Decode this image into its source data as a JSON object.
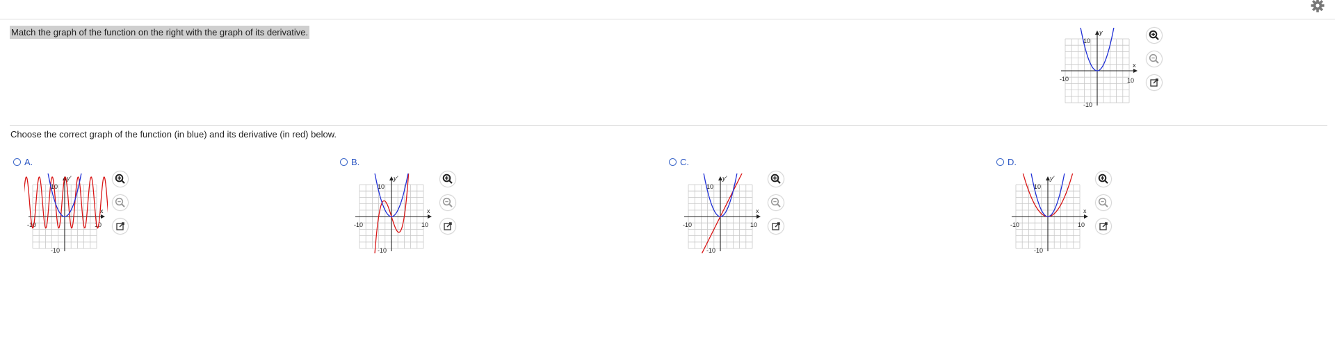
{
  "question": "Match the graph of the function on the right with the graph of its derivative.",
  "instruction": "Choose the correct graph of the function (in blue) and its derivative (in red) below.",
  "icons": {
    "settings": "gear-icon",
    "zoom_in": "zoom-in-icon",
    "zoom_out": "zoom-out-icon",
    "popout": "external-link-icon"
  },
  "colors": {
    "function": "#1f2fd6",
    "derivative": "#d91515",
    "option_label": "#2a55c3"
  },
  "given_graph": {
    "y_axis_label": "y",
    "x_axis_label": "x",
    "tick_min": "-10",
    "tick_max": "10",
    "tick_y_top": "10",
    "tick_y_bottom": "-10"
  },
  "options": [
    {
      "label": "A.",
      "y_axis_label": "y'",
      "x_axis_label": "x",
      "tick_min": "-10",
      "tick_max": "10",
      "tick_y_top": "10",
      "tick_y_bottom": "-10",
      "derivative_kind": "oscillating"
    },
    {
      "label": "B.",
      "y_axis_label": "y'",
      "x_axis_label": "x",
      "tick_min": "-10",
      "tick_max": "10",
      "tick_y_top": "10",
      "tick_y_bottom": "-10",
      "derivative_kind": "cubic"
    },
    {
      "label": "C.",
      "y_axis_label": "y'",
      "x_axis_label": "x",
      "tick_min": "-10",
      "tick_max": "10",
      "tick_y_top": "10",
      "tick_y_bottom": "-10",
      "derivative_kind": "linear"
    },
    {
      "label": "D.",
      "y_axis_label": "y'",
      "x_axis_label": "x",
      "tick_min": "-10",
      "tick_max": "10",
      "tick_y_top": "10",
      "tick_y_bottom": "-10",
      "derivative_kind": "parabola"
    }
  ]
}
